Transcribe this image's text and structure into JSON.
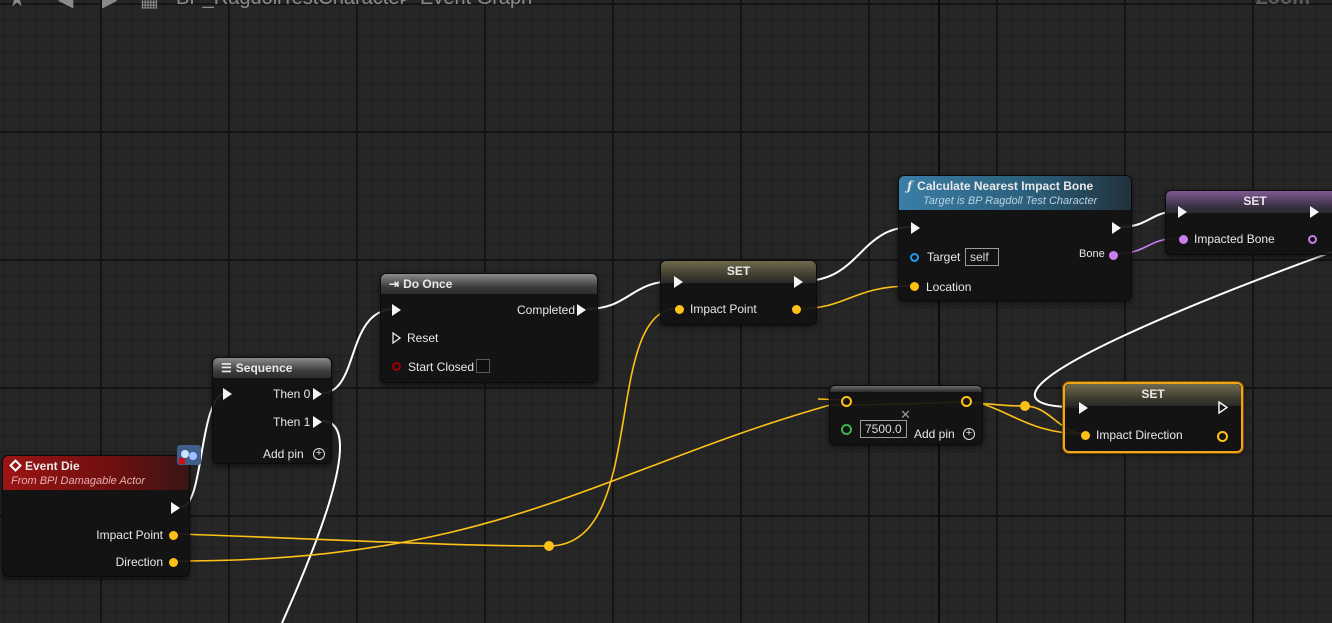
{
  "header": {
    "breadcrumb_blueprint": "BP_RagdollTestCharacter",
    "breadcrumb_separator": ">",
    "breadcrumb_graph": "Event Graph",
    "zoom": "Zoom"
  },
  "colors": {
    "exec_wire": "#ffffff",
    "vector_wire": "#fdc118",
    "name_wire": "#c97ff0",
    "selection": "#f0a418"
  },
  "nodes": {
    "event_die": {
      "title": "Event Die",
      "subtitle": "From BPI Damagable Actor",
      "impact_point": "Impact Point",
      "direction": "Direction"
    },
    "sequence": {
      "title": "Sequence",
      "then0": "Then 0",
      "then1": "Then 1",
      "add_pin": "Add pin"
    },
    "do_once": {
      "title": "Do Once",
      "completed": "Completed",
      "reset": "Reset",
      "start_closed": "Start Closed"
    },
    "set_impact_point": {
      "title": "SET",
      "pin_label": "Impact Point"
    },
    "calc_bone": {
      "title": "Calculate Nearest Impact Bone",
      "subtitle": "Target is BP Ragdoll Test Character",
      "target": "Target",
      "target_value": "self",
      "location": "Location",
      "bone": "Bone"
    },
    "set_impacted_bone": {
      "title": "SET",
      "pin_label": "Impacted Bone"
    },
    "multiply": {
      "value": "7500.0",
      "add_pin": "Add pin"
    },
    "set_impact_direction": {
      "title": "SET",
      "pin_label": "Impact Direction"
    }
  }
}
